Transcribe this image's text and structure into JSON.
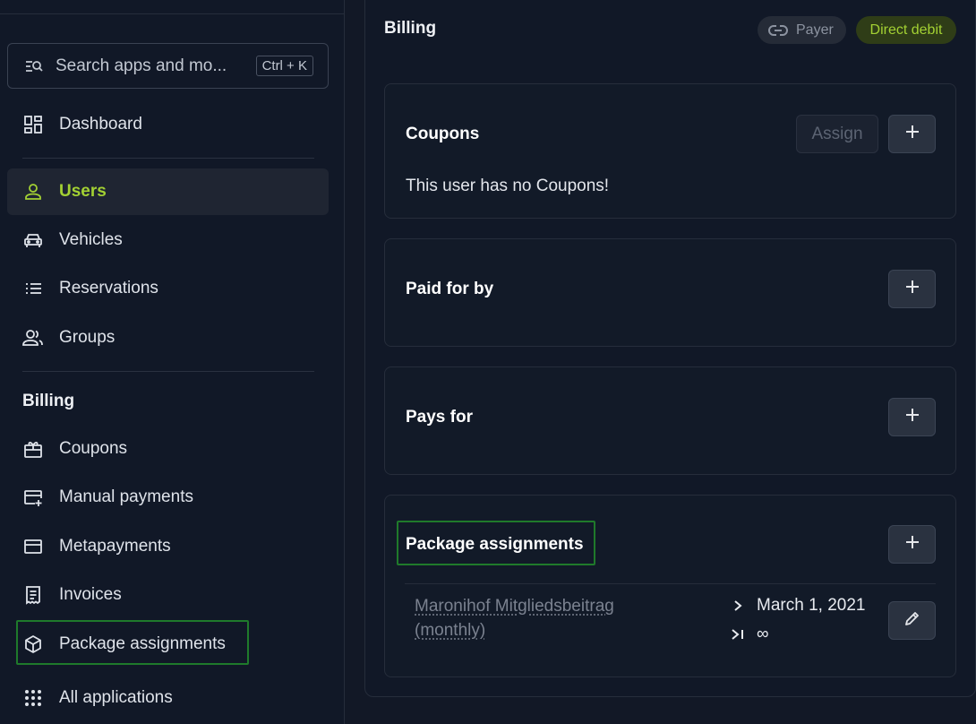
{
  "search": {
    "placeholder": "Search apps and mo...",
    "shortcut": "Ctrl + K"
  },
  "nav": {
    "dashboard": "Dashboard",
    "users": "Users",
    "vehicles": "Vehicles",
    "reservations": "Reservations",
    "groups": "Groups",
    "billing_section": "Billing",
    "coupons": "Coupons",
    "manual_payments": "Manual payments",
    "metapayments": "Metapayments",
    "invoices": "Invoices",
    "package_assignments": "Package assignments",
    "all_applications": "All applications"
  },
  "main": {
    "title": "Billing",
    "badges": {
      "payer": "Payer",
      "direct_debit": "Direct debit"
    },
    "coupons": {
      "title": "Coupons",
      "assign_label": "Assign",
      "empty_text": "This user has no Coupons!"
    },
    "paid_for_by": {
      "title": "Paid for by"
    },
    "pays_for": {
      "title": "Pays for"
    },
    "package_assignments": {
      "title": "Package assignments",
      "items": [
        {
          "name": "Maronihof Mitgliedsbeitrag (monthly)",
          "start": "March 1, 2021",
          "end": "∞"
        }
      ]
    }
  },
  "colors": {
    "accent": "#a3d133",
    "highlight_border": "#1f7a2b",
    "background": "#111827"
  }
}
